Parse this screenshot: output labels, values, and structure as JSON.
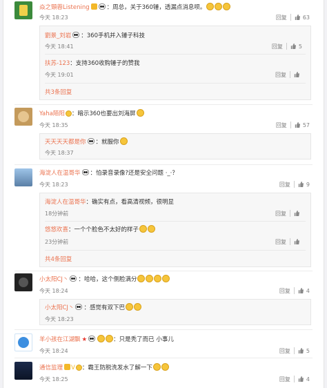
{
  "comments": [
    {
      "name": "焱之頸蓉Listening",
      "text": "：周总，关于360锤，透漏点消息呗。",
      "time": "今天 18:23",
      "likes": "63",
      "reply": "回复"
    },
    {
      "name": "Yaha陌阳",
      "text": "：暗示360也要出刘海屏",
      "time": "今天 18:35",
      "likes": "57",
      "reply": "回复"
    },
    {
      "name": "海淀人在温哥华",
      "text": "：怕录音录像?还是安全问题 ·_·？",
      "time": "今天 18:23",
      "likes": "9",
      "reply": "回复"
    },
    {
      "name": "小太阳CJ丶",
      "text": "：哈哈，这个侧脸满分",
      "time": "今天 18:24",
      "likes": "4",
      "reply": "回复"
    },
    {
      "name": "羊小孩在江湖飘",
      "text": "：只是秃了而已  小事儿",
      "time": "今天 18:24",
      "likes": "5",
      "reply": "回复"
    },
    {
      "name": "通信监理",
      "text": "：霸王防脱洗发水了解一下",
      "time": "今天 18:25",
      "likes": "4",
      "reply": "回复"
    }
  ],
  "replies": [
    {
      "name": "劉景_刘岩",
      "text": "：360手机并入锤子科技",
      "time": "今天 18:41",
      "likes": "5",
      "reply": "回复"
    },
    {
      "name": "扶苏-123",
      "text": "：支持360收购锤子的赞我",
      "time": "今天 19:01",
      "likes": "",
      "reply": "回复"
    },
    {
      "name": "天天天天都是你",
      "text": "：就服你",
      "time": "今天 18:37",
      "likes": "",
      "reply": "回复"
    },
    {
      "name": "海淀人在温哥华",
      "text": "：确实有点，看高清视频，很明显",
      "time": "18分钟前",
      "likes": "",
      "reply": "回复"
    },
    {
      "name": "悠悠欢喜",
      "text": "：一个个脸色不太好的样子",
      "time": "23分钟前",
      "likes": "",
      "reply": "回复"
    },
    {
      "name": "小太阳CJ丶",
      "text": "：感觉有双下巴",
      "time": "今天 18:23",
      "likes": "",
      "reply": "回复"
    }
  ],
  "more": [
    "共3条回复",
    "共4条回复"
  ]
}
